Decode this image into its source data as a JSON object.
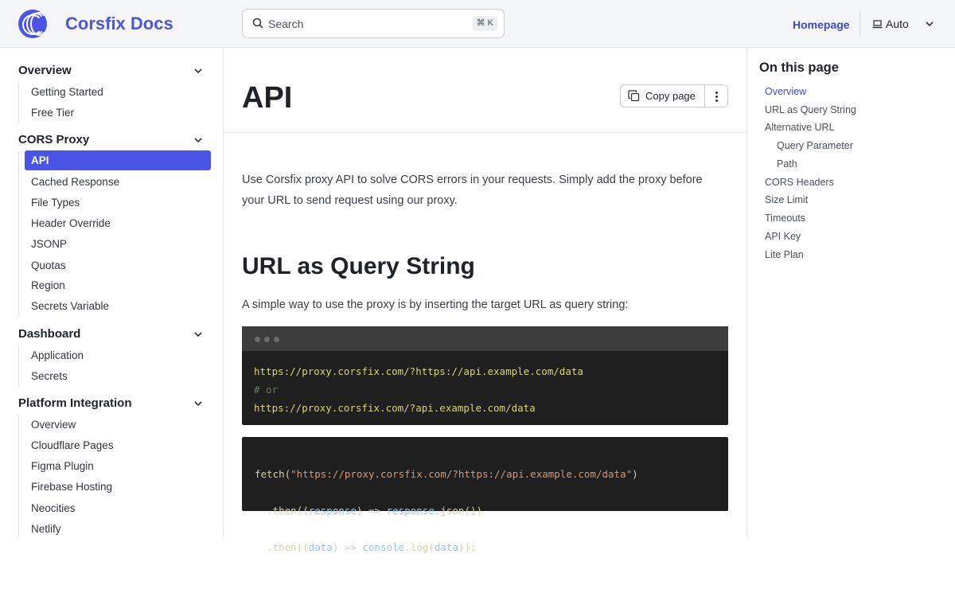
{
  "header": {
    "brand": "Corsfix Docs",
    "search_placeholder": "Search",
    "search_shortcut": "⌘ K",
    "homepage_link": "Homepage",
    "theme_label": "Auto",
    "brand_color": "#4a55e8"
  },
  "sidebar": {
    "sections": [
      {
        "title": "Overview",
        "items": [
          "Getting Started",
          "Free Tier"
        ]
      },
      {
        "title": "CORS Proxy",
        "items": [
          "API",
          "Cached Response",
          "File Types",
          "Header Override",
          "JSONP",
          "Quotas",
          "Region",
          "Secrets Variable"
        ]
      },
      {
        "title": "Dashboard",
        "items": [
          "Application",
          "Secrets"
        ]
      },
      {
        "title": "Platform Integration",
        "items": [
          "Overview",
          "Cloudflare Pages",
          "Figma Plugin",
          "Firebase Hosting",
          "Neocities",
          "Netlify"
        ]
      }
    ],
    "active_item": "API"
  },
  "main": {
    "title": "API",
    "copy_page_label": "Copy page",
    "intro_line1": "Use Corsfix proxy API to solve CORS errors in your requests. Simply add the proxy before",
    "intro_line2": "your URL to send request using our proxy.",
    "section_heading": "URL as Query String",
    "section_text": "A simple way to use the proxy is by inserting the target URL as query string:",
    "code1": {
      "line1": "https://proxy.corsfix.com/?https://api.example.com/data",
      "line2": "# or",
      "line3": "https://proxy.corsfix.com/?api.example.com/data"
    },
    "code2": {
      "l1_fn": "fetch(",
      "l1_str": "\"https://proxy.corsfix.com/?https://api.example.com/data\"",
      "l1_end": ")",
      "l2_a": "  .then((",
      "l2_b": "response",
      "l2_c": ") => ",
      "l2_d": "response",
      "l2_e": ".json())",
      "l3_a": "  .then((",
      "l3_b": "data",
      "l3_c": ") => ",
      "l3_d": "console",
      "l3_e": ".log(",
      "l3_f": "data",
      "l3_g": "));"
    }
  },
  "toc": {
    "title": "On this page",
    "items": [
      "Overview",
      "URL as Query String",
      "Alternative URL",
      "Query Parameter",
      "Path",
      "CORS Headers",
      "Size Limit",
      "Timeouts",
      "API Key",
      "Lite Plan"
    ],
    "active": "Overview"
  }
}
